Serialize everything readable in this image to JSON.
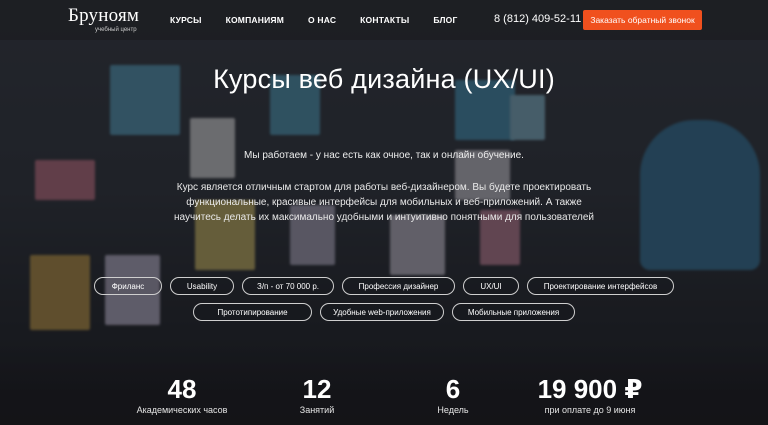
{
  "header": {
    "logo_name": "Бруноям",
    "logo_sub": "учебный центр",
    "nav": [
      "КУРСЫ",
      "КОМПАНИЯМ",
      "О НАС",
      "КОНТАКТЫ",
      "БЛОГ"
    ],
    "phone": "8 (812) 409-52-11",
    "callback_label": "Заказать обратный звонок"
  },
  "hero": {
    "title": "Курсы веб дизайна (UX/UI)",
    "tagline": "Мы работаем - у нас есть как очное, так и онлайн обучение.",
    "description": "Курс является отличным стартом для работы веб-дизайнером. Вы будете проектировать функциональные, красивые интерфейсы для мобильных и веб-приложений. А также научитесь делать их максимально удобными и интуитивно понятными для пользователей"
  },
  "tags": {
    "row1": [
      "Фриланс",
      "Usability",
      "З/п - от 70 000 р.",
      "Профессия дизайнер",
      "UX/UI",
      "Проектирование интерфейсов"
    ],
    "row2": [
      "Прототипирование",
      "Удобные web-приложения",
      "Мобильные приложения"
    ]
  },
  "stats": [
    {
      "value": "48",
      "label": "Академических часов"
    },
    {
      "value": "12",
      "label": "Занятий"
    },
    {
      "value": "6",
      "label": "Недель"
    },
    {
      "value": "19 900 ₽",
      "label": "при оплате до 9 июня"
    }
  ],
  "colors": {
    "accent": "#f0501e",
    "header_bg": "#1e1f23"
  }
}
